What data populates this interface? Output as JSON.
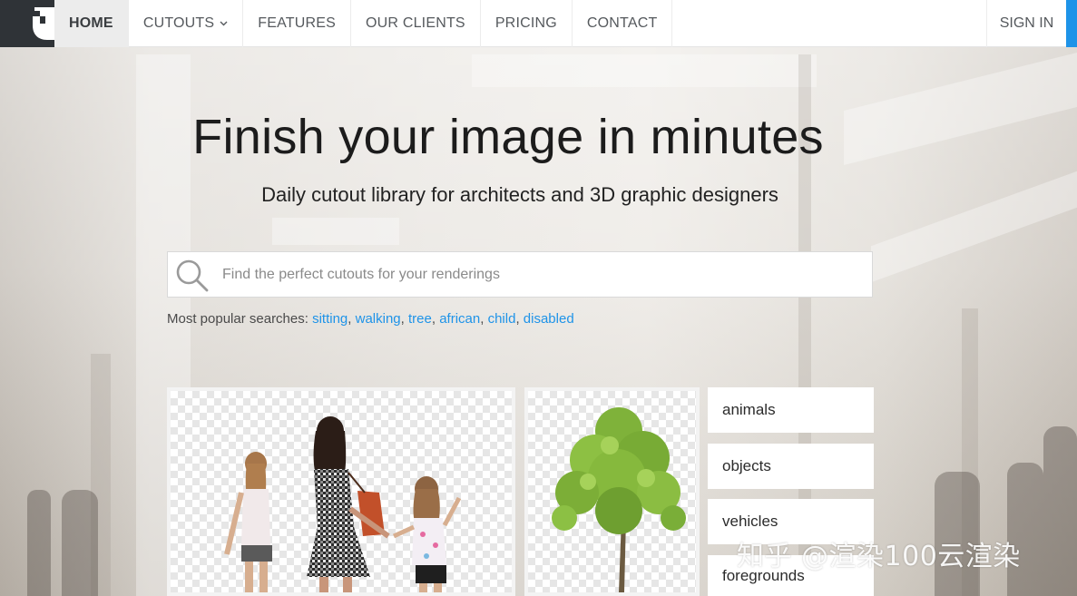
{
  "nav": {
    "items": [
      {
        "label": "HOME",
        "active": true
      },
      {
        "label": "CUTOUTS",
        "dropdown": true
      },
      {
        "label": "FEATURES"
      },
      {
        "label": "OUR CLIENTS"
      },
      {
        "label": "PRICING"
      },
      {
        "label": "CONTACT"
      }
    ],
    "signin": "SIGN IN"
  },
  "hero": {
    "title": "Finish your image in minutes",
    "subtitle": "Daily cutout library for architects and 3D graphic designers"
  },
  "search": {
    "placeholder": "Find the perfect cutouts for your renderings",
    "icon": "search-icon"
  },
  "popular": {
    "label": "Most popular searches:",
    "terms": [
      "sitting",
      "walking",
      "tree",
      "african",
      "child",
      "disabled"
    ]
  },
  "categories": [
    "animals",
    "objects",
    "vehicles",
    "foregrounds"
  ],
  "watermark": "知乎 @渲染100云渲染",
  "colors": {
    "accent": "#1e93e8",
    "logo_bg": "#2f3337",
    "active_tab_bg": "#ececec"
  }
}
